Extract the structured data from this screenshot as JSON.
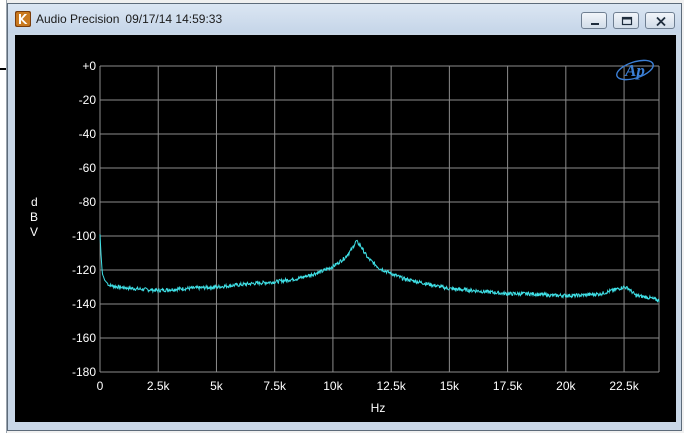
{
  "window": {
    "app_name": "Audio Precision",
    "timestamp": "09/17/14 14:59:33",
    "app_icon": "audio-precision-app-icon",
    "controls": [
      {
        "name": "minimize-button",
        "icon": "minimize-icon"
      },
      {
        "name": "maximize-button",
        "icon": "maximize-icon"
      },
      {
        "name": "close-button",
        "icon": "close-icon"
      }
    ]
  },
  "logo": {
    "text": "Ap"
  },
  "colors": {
    "trace": "#3fe0e6",
    "grid": "#8c8c8c",
    "background": "#000000",
    "text": "#ffffff",
    "logo": "#3b7fd6"
  },
  "chart_data": {
    "type": "line",
    "title": "",
    "xlabel": "Hz",
    "ylabel": "dBV",
    "xlim": [
      0,
      24000
    ],
    "ylim": [
      -180,
      0
    ],
    "x_ticks": [
      {
        "value": 0,
        "label": "0"
      },
      {
        "value": 2500,
        "label": "2.5k"
      },
      {
        "value": 5000,
        "label": "5k"
      },
      {
        "value": 7500,
        "label": "7.5k"
      },
      {
        "value": 10000,
        "label": "10k"
      },
      {
        "value": 12500,
        "label": "12.5k"
      },
      {
        "value": 15000,
        "label": "15k"
      },
      {
        "value": 17500,
        "label": "17.5k"
      },
      {
        "value": 20000,
        "label": "20k"
      },
      {
        "value": 22500,
        "label": "22.5k"
      }
    ],
    "y_ticks": [
      {
        "value": 0,
        "label": "+0"
      },
      {
        "value": -20,
        "label": "-20"
      },
      {
        "value": -40,
        "label": "-40"
      },
      {
        "value": -60,
        "label": "-60"
      },
      {
        "value": -80,
        "label": "-80"
      },
      {
        "value": -100,
        "label": "-100"
      },
      {
        "value": -120,
        "label": "-120"
      },
      {
        "value": -140,
        "label": "-140"
      },
      {
        "value": -160,
        "label": "-160"
      },
      {
        "value": -180,
        "label": "-180"
      }
    ],
    "grid": true,
    "series": [
      {
        "x": [
          0,
          40,
          100,
          200,
          400,
          800,
          1500,
          2500,
          3500,
          5000,
          6500,
          7500,
          8500,
          9500,
          10000,
          10500,
          10800,
          11000,
          11200,
          11500,
          12000,
          12500,
          13000,
          14000,
          15000,
          16000,
          17500,
          18500,
          19500,
          20500,
          21500,
          22000,
          22500,
          22700,
          23000,
          23500,
          24000
        ],
        "y": [
          -99,
          -110,
          -122,
          -126,
          -129,
          -130,
          -131,
          -132,
          -131,
          -130,
          -128,
          -127,
          -125,
          -121,
          -118,
          -113,
          -108,
          -103,
          -106,
          -113,
          -119,
          -122,
          -125,
          -128,
          -131,
          -132,
          -134,
          -134,
          -135,
          -135,
          -134,
          -132,
          -130,
          -131,
          -135,
          -136,
          -138
        ]
      }
    ]
  }
}
